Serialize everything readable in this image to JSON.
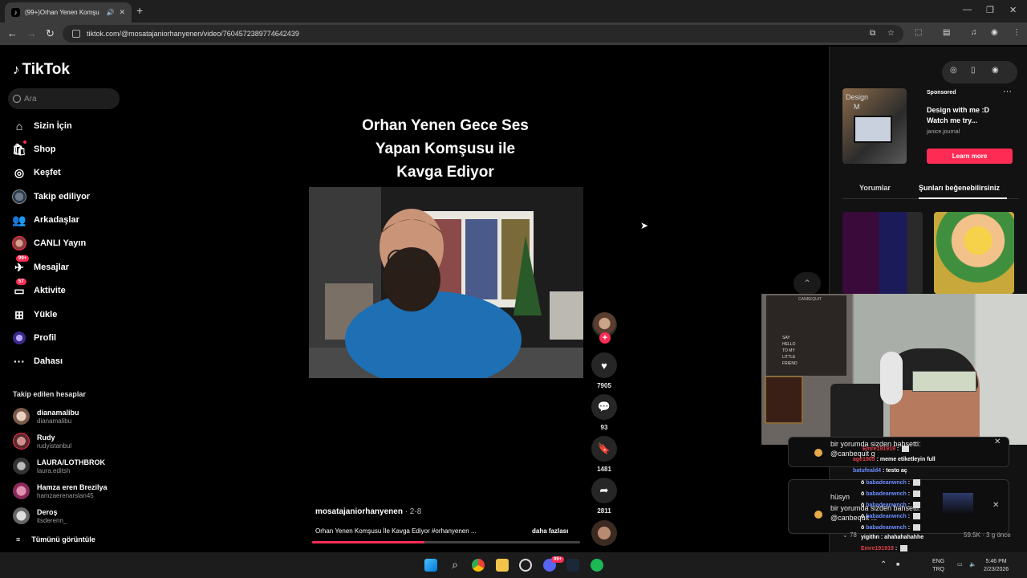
{
  "browser": {
    "tab_title": "(99+)Orhan Yenen Komşu",
    "url": "tiktok.com/@mosatajaniorhanyenen/video/7604572389774642439"
  },
  "sidebar": {
    "logo": "TikTok",
    "search_placeholder": "Ara",
    "nav": [
      {
        "label": "Sizin İçin"
      },
      {
        "label": "Shop"
      },
      {
        "label": "Keşfet"
      },
      {
        "label": "Takip ediliyor"
      },
      {
        "label": "Arkadaşlar"
      },
      {
        "label": "CANLI Yayın"
      },
      {
        "label": "Mesajlar",
        "badge": "99+"
      },
      {
        "label": "Aktivite",
        "badge": "57"
      },
      {
        "label": "Yükle"
      },
      {
        "label": "Profil"
      },
      {
        "label": "Dahası"
      }
    ],
    "following_title": "Takip edilen hesaplar",
    "accounts": [
      {
        "name": "dianamalibu",
        "handle": "dianamalibu"
      },
      {
        "name": "Rudy",
        "handle": "rudyistanbul"
      },
      {
        "name": "LAURA/LOTHBROK",
        "handle": "laura.editsh"
      },
      {
        "name": "Hamza eren Brezilya",
        "handle": "hamzaerenarslan45"
      },
      {
        "name": "Deroş",
        "handle": "itsderenn_"
      }
    ],
    "see_all": "Tümünü görüntüle"
  },
  "video": {
    "title_lines": [
      "Orhan Yenen Gece Ses",
      "Yapan Komşusu ile",
      "Kavga  Ediyor"
    ],
    "author": "mosatajaniorhanyenen",
    "date": " · 2-8",
    "description": "Orhan Yenen Komşusu İle Kavga Ediyor #orhanyenen ...",
    "more": "daha fazlası",
    "progress": 0.42,
    "likes": "7905",
    "comments": "93",
    "saves": "1481",
    "shares": "2811"
  },
  "right_panel": {
    "ad_overlay_1": "Design",
    "ad_overlay_2": "M",
    "sponsored": "Sponsored",
    "ad_title": "Design with me :D Watch me try...",
    "ad_source": "janice.journal",
    "learn_more": "Learn more",
    "tab_comments": "Yorumlar",
    "tab_you_may_like": "Şunları beğenebilirsiniz"
  },
  "stream_overlay": {
    "notif1_line1": "bir yorumda sizden bahsetti:",
    "notif1_line2": "@canbequit g",
    "notif2_user": "hüsyn",
    "notif2_line1": "bir yorumda sizden bahsetti:",
    "notif2_line2": "@canbequit ...",
    "poster_text": [
      "SAY",
      "HELLO",
      "TO MY",
      "LITTLE",
      "FRIEND"
    ],
    "cam_logo": "CANBEQUIT",
    "chat": [
      {
        "user": "Emre191919",
        "msg": " : ",
        "color": "red"
      },
      {
        "user": "age1905",
        "msg": " : meme etiketleyin full",
        "color": "red"
      },
      {
        "user": "batufeald4",
        "msg": " : testo aç",
        "color": "blue"
      },
      {
        "user": "babadeanwnch",
        "msg": " : ",
        "color": "blue"
      },
      {
        "user": "babadeanwnch",
        "msg": " : ",
        "color": "blue"
      },
      {
        "user": "babadeanwnch",
        "msg": " : ",
        "color": "blue"
      },
      {
        "user": "babadeanwnch",
        "msg": " : ",
        "color": "blue"
      },
      {
        "user": "babadeanwnch",
        "msg": " : ",
        "color": "blue"
      },
      {
        "user": "yigithn",
        "msg": " : ahahahahahhe",
        "color": "white"
      },
      {
        "user": "Emre191919",
        "msg": " : ",
        "color": "red"
      },
      {
        "user": "Emre191919",
        "msg": " : ",
        "color": "red"
      },
      {
        "user": "Emre191919",
        "msg": " : ",
        "color": "red"
      }
    ],
    "below_left": "78",
    "below_mid": "59.5K",
    "below_right": "3 g önce"
  },
  "taskbar": {
    "lang_top": "ENG",
    "lang_bottom": "TRQ",
    "time": "5:46 PM",
    "date": "2/23/2026",
    "discord_badge": "99+"
  },
  "colors": {
    "accent": "#fe2c55",
    "page_bg": "#000000",
    "panel_bg": "#121212"
  }
}
